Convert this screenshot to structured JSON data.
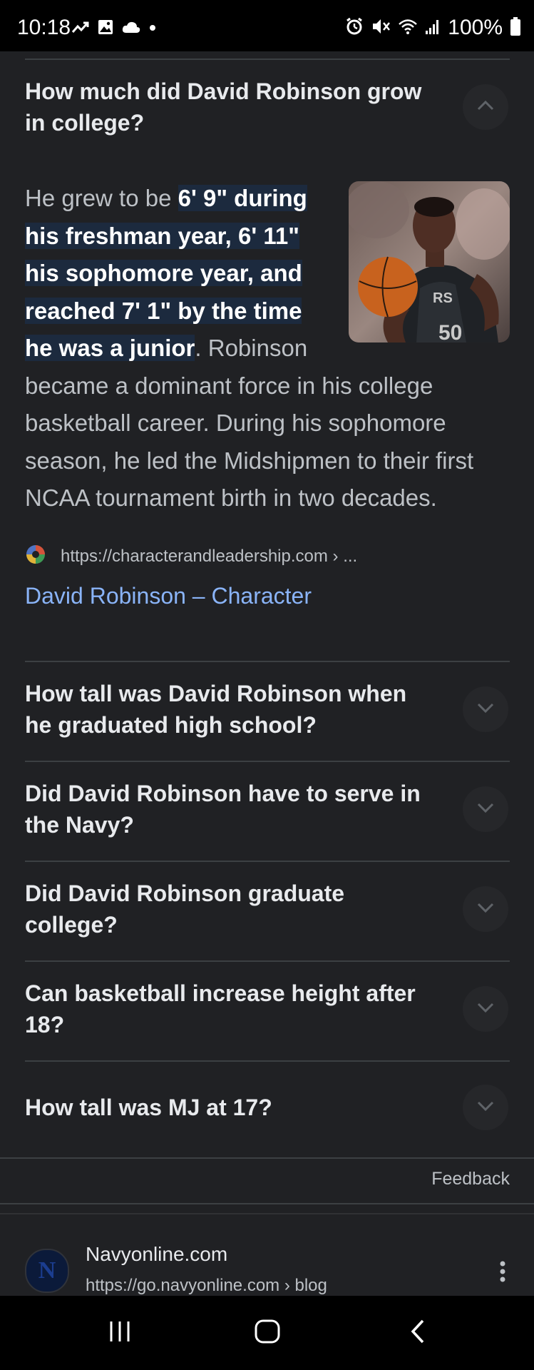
{
  "status_bar": {
    "time": "10:18",
    "battery": "100%",
    "icons": [
      "trending-icon",
      "gallery-icon",
      "cloud-icon",
      "dot-icon",
      "alarm-icon",
      "mute-icon",
      "wifi-icon",
      "signal-icon",
      "battery-icon"
    ]
  },
  "expanded_faq": {
    "question": "How much did David Robinson grow in college?",
    "answer_lead": "He grew to be ",
    "answer_highlight": "6' 9\" during his freshman year, 6' 11\" his sophomore year, and reached 7' 1\" by the time he was a junior",
    "answer_rest": ". Robinson became a dominant force in his college basketball career. During his sophomore season, he led the Midshipmen to their first NCAA tournament birth in two decades.",
    "source_url": "https://characterandleadership.com › ...",
    "source_title": "David Robinson – Character"
  },
  "faqs": [
    {
      "question": "How tall was David Robinson when he graduated high school?"
    },
    {
      "question": "Did David Robinson have to serve in the Navy?"
    },
    {
      "question": "Did David Robinson graduate college?"
    },
    {
      "question": "Can basketball increase height after 18?"
    },
    {
      "question": "How tall was MJ at 17?"
    }
  ],
  "feedback_label": "Feedback",
  "next_result": {
    "logo_letter": "N",
    "site_name": "Navyonline.com",
    "url": "https://go.navyonline.com › blog"
  },
  "colors": {
    "background": "#202124",
    "link": "#8ab4f8",
    "highlight": "#1c2a3e"
  }
}
